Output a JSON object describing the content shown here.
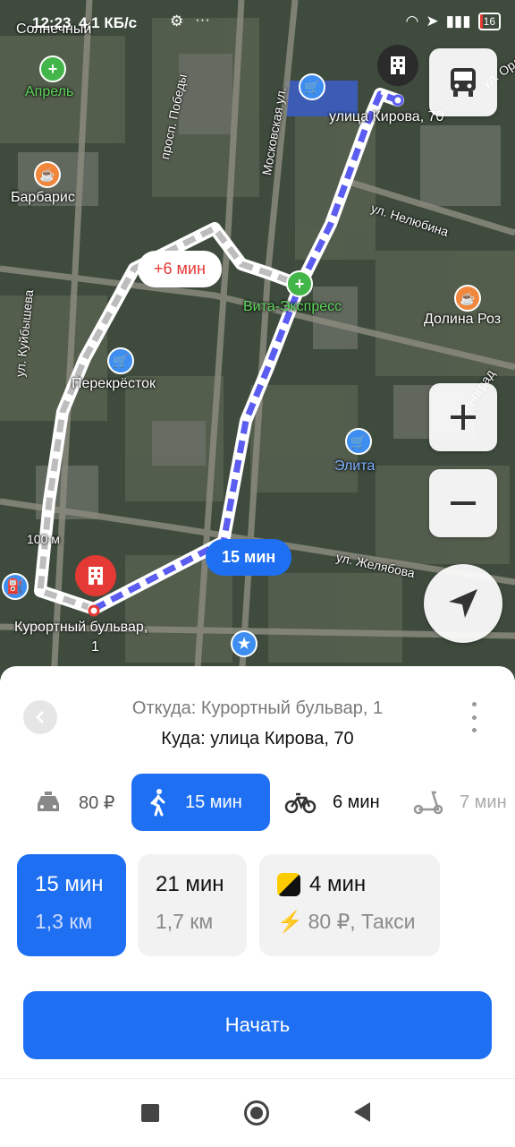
{
  "status_bar": {
    "time": "12:23",
    "network_speed": "4,1 КБ/с",
    "battery": "16",
    "battery_level": 0.16
  },
  "map": {
    "place_labels": {
      "solnechny": "Солнечный",
      "aprel": "Апрель",
      "barbaris": "Барбарис",
      "vita_express": "Вита-Экспресс",
      "dolina_roz": "Долина Роз",
      "perekrestok": "Перекрёсток",
      "elita": "Элита",
      "kurortny_bulvar": "Курортный бульвар,",
      "kurortny_bulvar_num": "1",
      "ulitsa_kirova": "улица Кирова, 70",
      "scale": "100 м"
    },
    "street_labels": {
      "prosp_pobedy": "просп. Победы",
      "moskovskaya": "Московская ул.",
      "ul_nelyubina": "ул. Нелюбина",
      "ul_kuybysheva": "ул. Куйбышева",
      "ul_zhelyabova": "ул. Желябова",
      "ul_orzhonikidze": "ул. Орджо",
      "vinogradnaya": "Виноград"
    },
    "route_bubbles": {
      "alt_delta": "+6 мин",
      "main_time": "15 мин"
    },
    "colors": {
      "route_main": "#5b5cf0",
      "route_alt": "#bdbdbd",
      "accent": "#1e6ff2",
      "pin_red": "#e53935"
    }
  },
  "route_panel": {
    "from": "Откуда: Курортный бульвар, 1",
    "to": "Куда: улица Кирова, 70",
    "modes": [
      {
        "icon": "car-icon",
        "label": "80 ₽"
      },
      {
        "icon": "walk-icon",
        "label": "15 мин",
        "active": true
      },
      {
        "icon": "bike-icon",
        "label": "6 мин"
      },
      {
        "icon": "scooter-icon",
        "label": "7 мин"
      }
    ],
    "options": [
      {
        "time": "15 мин",
        "detail": "1,3 км",
        "active": true
      },
      {
        "time": "21 мин",
        "detail": "1,7 км"
      },
      {
        "time": "4 мин",
        "detail": "80 ₽, Такси",
        "icon": "yandex-taxi-icon"
      }
    ],
    "start_label": "Начать"
  }
}
